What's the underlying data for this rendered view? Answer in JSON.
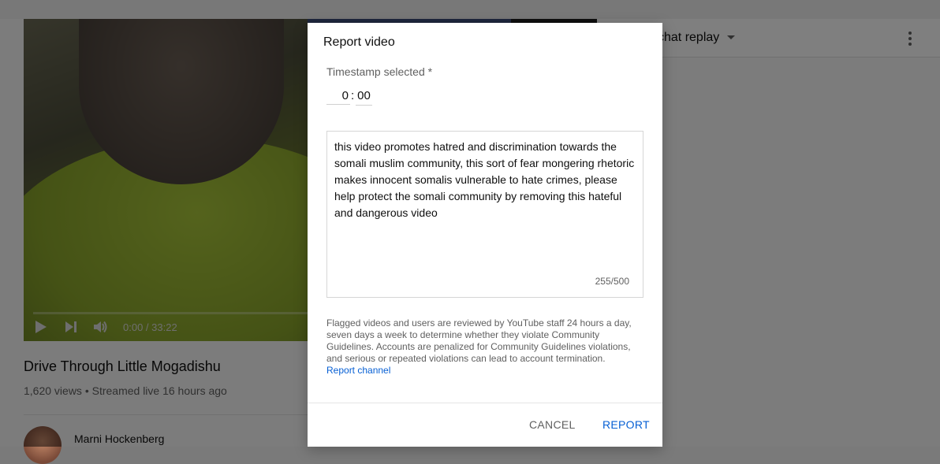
{
  "player": {
    "time_display": "0:00 / 33:22"
  },
  "video": {
    "title": "Drive Through Little Mogadishu",
    "meta": "1,620 views • Streamed live 16 hours ago",
    "channel_name": "Marni Hockenberg"
  },
  "chat": {
    "title": "chat replay"
  },
  "dialog": {
    "title": "Report video",
    "timestamp_label": "Timestamp selected *",
    "timestamp_minutes": "0",
    "timestamp_seconds": "00",
    "report_text": "this video promotes hatred and discrimination towards the somali muslim community, this sort of fear mongering rhetoric makes innocent somalis vulnerable to hate crimes, please help protect the somali community by removing this hateful and dangerous video",
    "char_count": "255/500",
    "notice": "Flagged videos and users are reviewed by YouTube staff 24 hours a day, seven days a week to determine whether they violate Community Guidelines. Accounts are penalized for Community Guidelines violations, and serious or repeated violations can lead to account termination.",
    "report_channel_label": "Report channel",
    "cancel_label": "CANCEL",
    "report_label": "REPORT"
  },
  "colors": {
    "accent": "#065fd4",
    "secondary_text": "#606060"
  }
}
